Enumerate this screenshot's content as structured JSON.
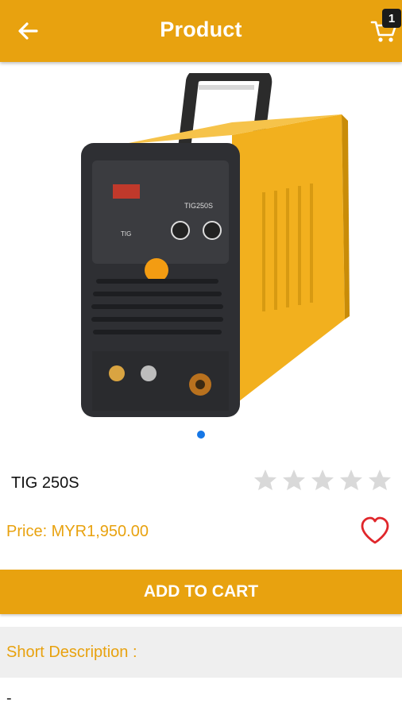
{
  "header": {
    "title": "Product",
    "cart_count": "1",
    "back_icon": "arrow-left-icon",
    "cart_icon": "cart-icon",
    "color": "#E8A20F"
  },
  "product": {
    "image": "welding-machine-image",
    "carousel_pages": 1,
    "carousel_active": 1,
    "name": "TIG 250S",
    "rating": {
      "stars": 0,
      "max": 5
    },
    "price": "Price: MYR1,950.00",
    "wishlist_icon": "heart-outline-icon",
    "image_label_model": "TIG250S",
    "image_label_mode": "TIG"
  },
  "actions": {
    "add_to_cart_label": "ADD TO CART"
  },
  "description": {
    "label": "Short Description :",
    "value": "-"
  },
  "colors": {
    "accent": "#E8A20F",
    "dot_active": "#1677E6",
    "star_empty": "#D9D9D9",
    "heart": "#E0262B"
  }
}
